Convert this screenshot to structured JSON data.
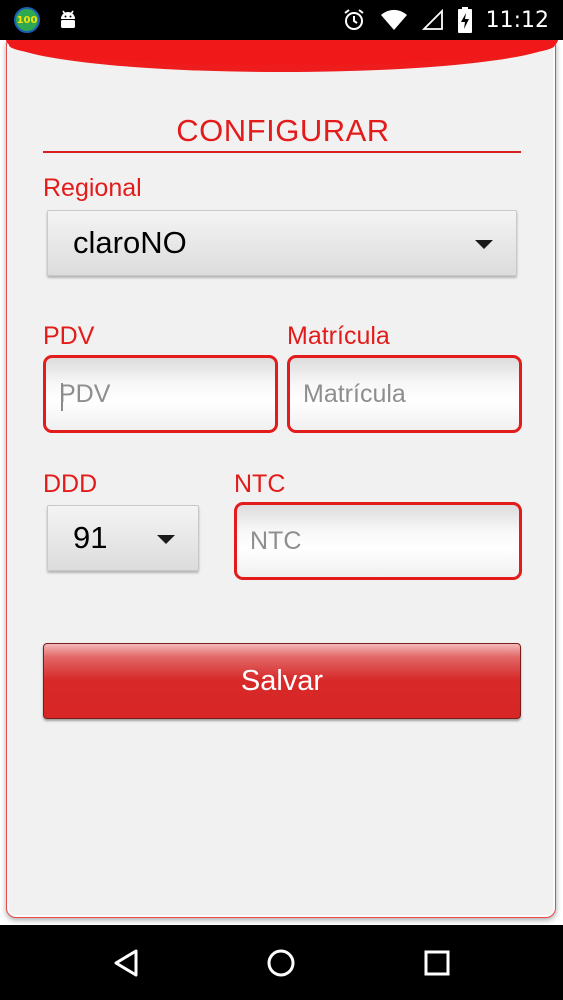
{
  "status_bar": {
    "notification_badge": "100",
    "time": "11:12"
  },
  "form": {
    "title": "CONFIGURAR",
    "regional": {
      "label": "Regional",
      "selected": "claroNO"
    },
    "pdv": {
      "label": "PDV",
      "placeholder": "PDV",
      "value": ""
    },
    "matricula": {
      "label": "Matrícula",
      "placeholder": "Matrícula",
      "value": ""
    },
    "ddd": {
      "label": "DDD",
      "selected": "91"
    },
    "ntc": {
      "label": "NTC",
      "placeholder": "NTC",
      "value": ""
    },
    "save_label": "Salvar"
  },
  "colors": {
    "accent": "#e41b1b",
    "card_background": "#f1f1f1",
    "button": "#d82626"
  },
  "icons": {
    "status_left": [
      "badge-100-icon",
      "android-icon"
    ],
    "status_right": [
      "alarm-icon",
      "wifi-icon",
      "battery-charging-icon"
    ],
    "navigation": [
      "back-icon",
      "home-icon",
      "recents-icon"
    ]
  }
}
